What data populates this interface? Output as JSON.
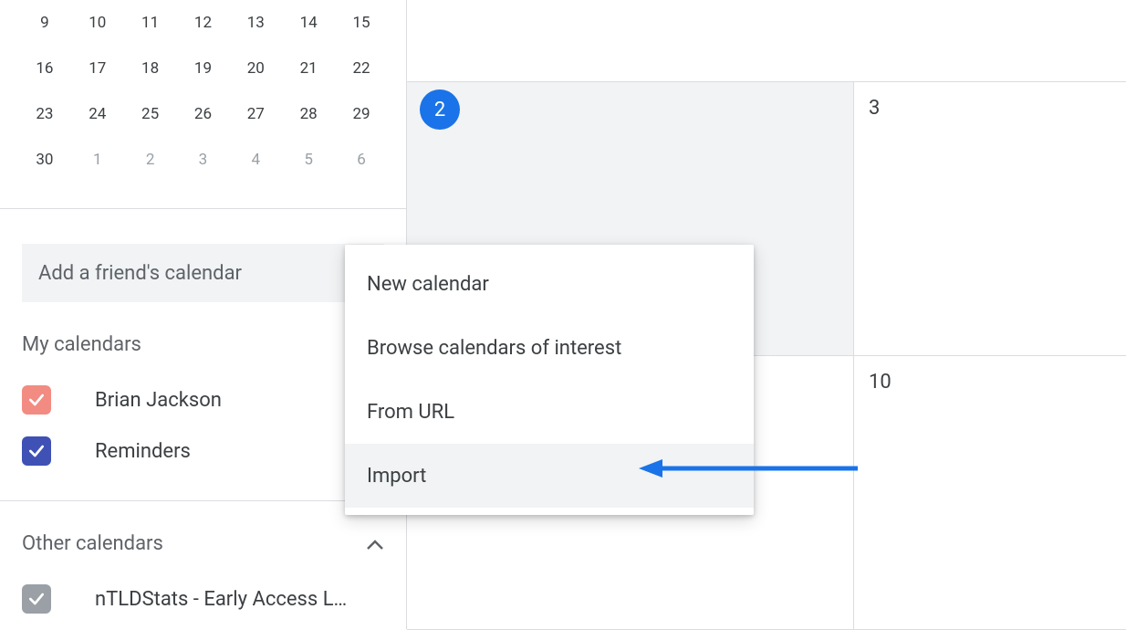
{
  "mini_calendar": {
    "rows": [
      {
        "cells": [
          {
            "d": "9",
            "other": false
          },
          {
            "d": "10",
            "other": false
          },
          {
            "d": "11",
            "other": false
          },
          {
            "d": "12",
            "other": false
          },
          {
            "d": "13",
            "other": false
          },
          {
            "d": "14",
            "other": false
          },
          {
            "d": "15",
            "other": false
          }
        ]
      },
      {
        "cells": [
          {
            "d": "16",
            "other": false
          },
          {
            "d": "17",
            "other": false
          },
          {
            "d": "18",
            "other": false
          },
          {
            "d": "19",
            "other": false
          },
          {
            "d": "20",
            "other": false
          },
          {
            "d": "21",
            "other": false
          },
          {
            "d": "22",
            "other": false
          }
        ]
      },
      {
        "cells": [
          {
            "d": "23",
            "other": false
          },
          {
            "d": "24",
            "other": false
          },
          {
            "d": "25",
            "other": false
          },
          {
            "d": "26",
            "other": false
          },
          {
            "d": "27",
            "other": false
          },
          {
            "d": "28",
            "other": false
          },
          {
            "d": "29",
            "other": false
          }
        ]
      },
      {
        "cells": [
          {
            "d": "30",
            "other": false
          },
          {
            "d": "1",
            "other": true
          },
          {
            "d": "2",
            "other": true
          },
          {
            "d": "3",
            "other": true
          },
          {
            "d": "4",
            "other": true
          },
          {
            "d": "5",
            "other": true
          },
          {
            "d": "6",
            "other": true
          }
        ]
      }
    ]
  },
  "add_friend_placeholder": "Add a friend's calendar",
  "sections": {
    "my_calendars_title": "My calendars",
    "other_calendars_title": "Other calendars"
  },
  "my_calendars": [
    {
      "label": "Brian Jackson",
      "color": "#f28b82",
      "checked": true
    },
    {
      "label": "Reminders",
      "color": "#3f51b5",
      "checked": true
    }
  ],
  "other_calendars": [
    {
      "label": "nTLDStats - Early Access L…",
      "color": "#9aa0a6",
      "checked": true
    }
  ],
  "menu": {
    "items": [
      {
        "label": "New calendar",
        "highlight": false
      },
      {
        "label": "Browse calendars of interest",
        "highlight": false
      },
      {
        "label": "From URL",
        "highlight": false
      },
      {
        "label": "Import",
        "highlight": true
      }
    ]
  },
  "month_cells": {
    "row1_left": {
      "num": "2",
      "today": true
    },
    "row1_right": {
      "num": "3",
      "today": false
    },
    "row2_right": {
      "num": "10",
      "today": false
    }
  },
  "colors": {
    "accent": "#1a73e8",
    "arrow": "#1a73e8"
  }
}
